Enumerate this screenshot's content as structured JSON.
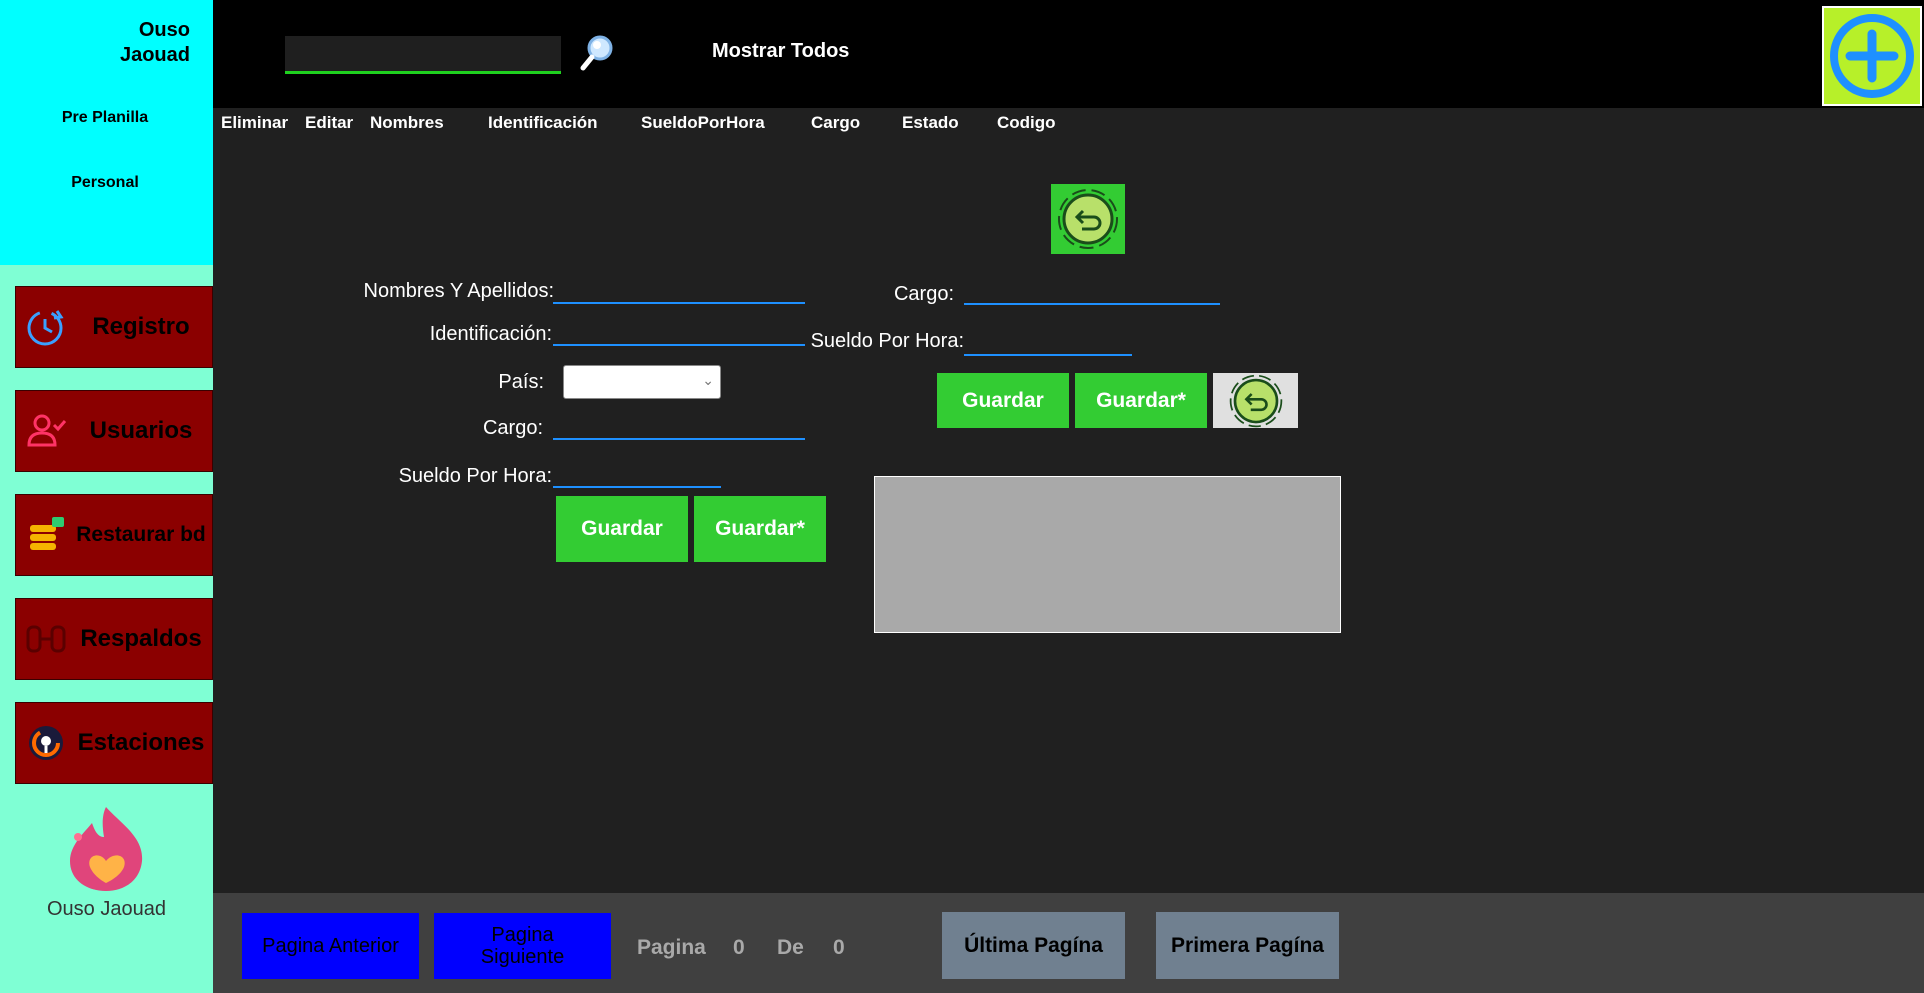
{
  "sidebar": {
    "user_line1": "Ouso",
    "user_line2": "Jaouad",
    "links": [
      "Pre Planilla",
      "Personal"
    ],
    "nav": [
      {
        "label": "Registro",
        "icon": "clock-refresh-icon"
      },
      {
        "label": "Usuarios",
        "icon": "user-check-icon"
      },
      {
        "label": "Restaurar bd",
        "icon": "database-icon"
      },
      {
        "label": "Respaldos",
        "icon": "backup-icon"
      },
      {
        "label": "Estaciones",
        "icon": "station-pin-icon"
      }
    ],
    "footer_name": "Ouso Jaouad"
  },
  "topbar": {
    "search_value": "",
    "show_all": "Mostrar Todos"
  },
  "columns": [
    "Eliminar",
    "Editar",
    "Nombres",
    "Identificación",
    "SueldoPorHora",
    "Cargo",
    "Estado",
    "Codigo"
  ],
  "form_left": {
    "nombres_label": "Nombres Y Apellidos:",
    "identificacion_label": "Identificación:",
    "pais_label": "País:",
    "pais_value": "",
    "cargo_label": "Cargo:",
    "sueldo_label": "Sueldo Por Hora:",
    "guardar": "Guardar",
    "guardar_star": "Guardar*"
  },
  "form_right": {
    "cargo_label": "Cargo:",
    "sueldo_label": "Sueldo Por Hora:",
    "guardar": "Guardar",
    "guardar_star": "Guardar*"
  },
  "pager": {
    "prev": "Pagina Anterior",
    "next": "Pagina Siguiente",
    "pagina_label": "Pagina",
    "current": "0",
    "de_label": "De",
    "total": "0",
    "last": "Última Pagína",
    "first": "Primera Pagína"
  },
  "colors": {
    "sidebar_top": "#00ffff",
    "sidebar_bottom": "#7fffd4",
    "nav_button": "#8b0000",
    "accent_green": "#33cc33",
    "add_button": "#b7f029"
  }
}
